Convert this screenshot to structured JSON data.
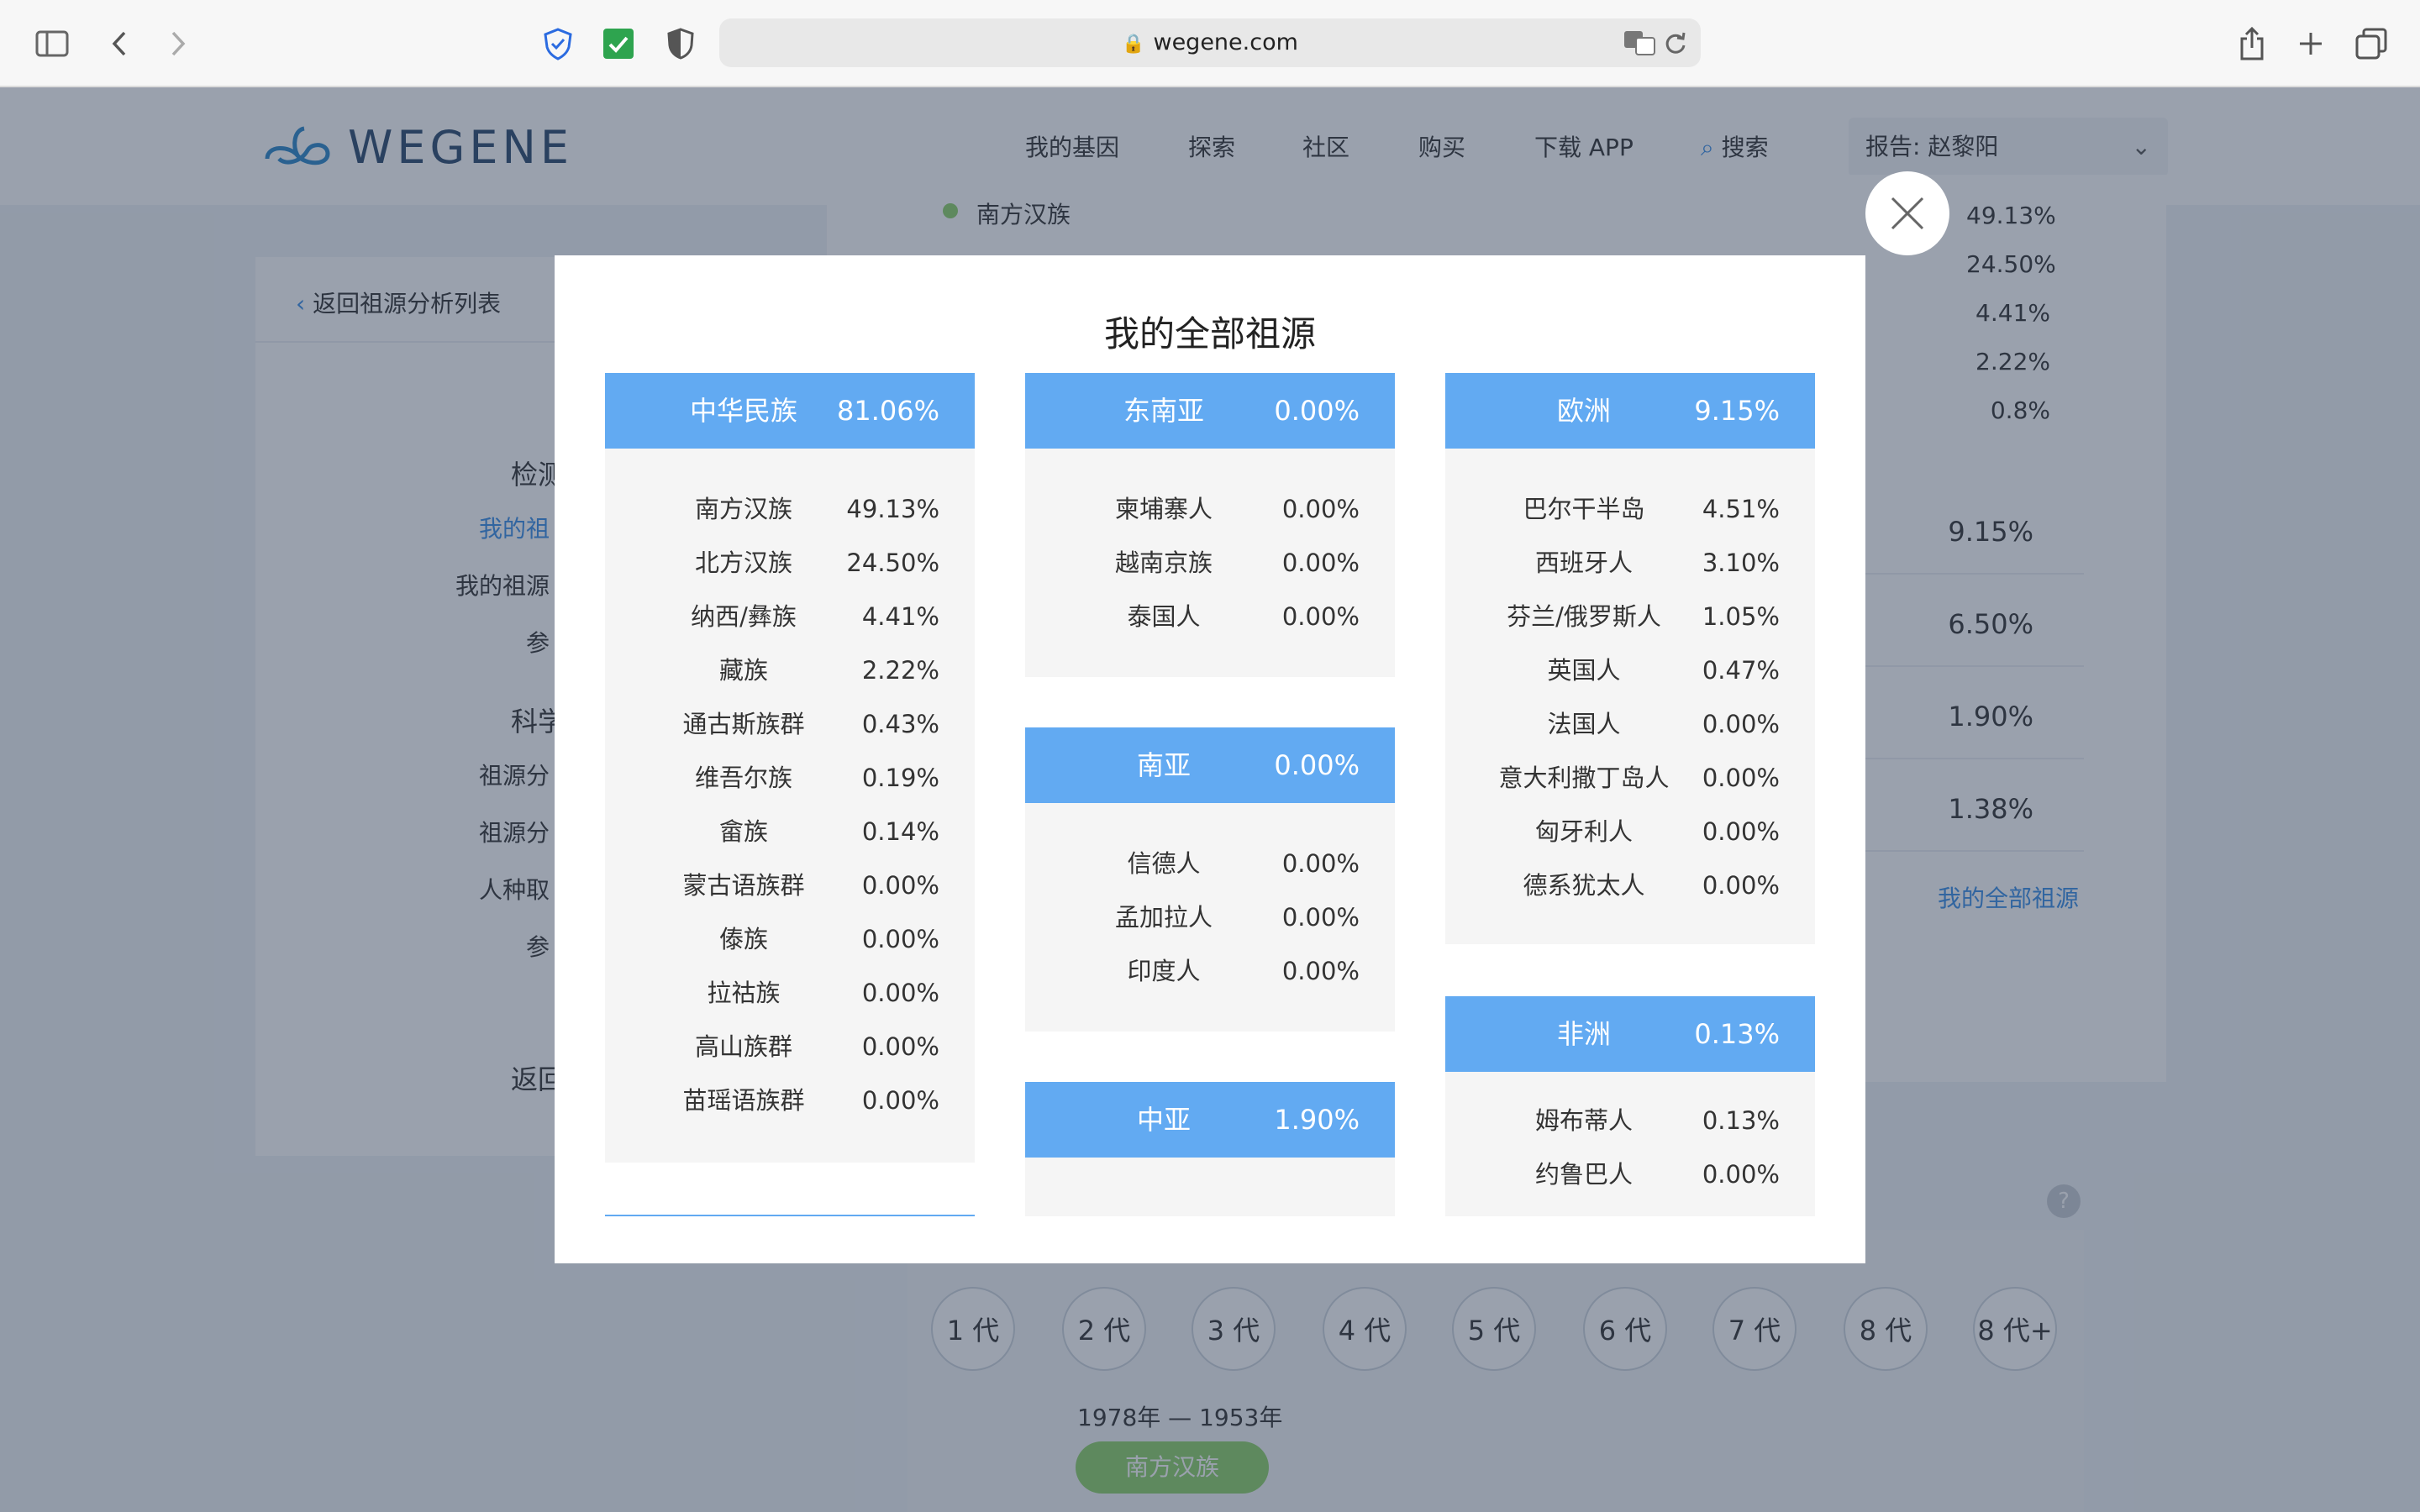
{
  "browser": {
    "url": "wegene.com"
  },
  "site": {
    "logo_text": "WEGENE",
    "nav": [
      "我的基因",
      "探索",
      "社区",
      "购买",
      "下载 APP"
    ],
    "search_label": "搜索",
    "report_label": "报告: 赵黎阳"
  },
  "sidebar": {
    "back_label": "返回祖源分析列表",
    "items": [
      "检测",
      "我的祖",
      "我的祖源",
      "参",
      "科学",
      "祖源分",
      "祖源分",
      "人种取",
      "参",
      "返回"
    ]
  },
  "background": {
    "legend": [
      {
        "name": "南方汉族",
        "pct": "49.13%"
      },
      {
        "name": "",
        "pct": "24.50%"
      },
      {
        "name": "",
        "pct": "4.41%"
      },
      {
        "name": "",
        "pct": "2.22%"
      },
      {
        "name": "",
        "pct": "0.8%"
      }
    ],
    "region_pcts": [
      "9.15%",
      "6.50%",
      "1.90%",
      "1.38%"
    ],
    "all_link": "我的全部祖源",
    "generations": [
      "1 代",
      "2 代",
      "3 代",
      "4 代",
      "5 代",
      "6 代",
      "7 代",
      "8 代",
      "8 代+"
    ],
    "years": "1978年 — 1953年",
    "gen_tag": "南方汉族"
  },
  "modal": {
    "title": "我的全部祖源",
    "columns": [
      [
        {
          "name": "中华民族",
          "pct": "81.06%",
          "rows": [
            [
              "南方汉族",
              "49.13%"
            ],
            [
              "北方汉族",
              "24.50%"
            ],
            [
              "纳西/彝族",
              "4.41%"
            ],
            [
              "藏族",
              "2.22%"
            ],
            [
              "通古斯族群",
              "0.43%"
            ],
            [
              "维吾尔族",
              "0.19%"
            ],
            [
              "畲族",
              "0.14%"
            ],
            [
              "蒙古语族群",
              "0.00%"
            ],
            [
              "傣族",
              "0.00%"
            ],
            [
              "拉祜族",
              "0.00%"
            ],
            [
              "高山族群",
              "0.00%"
            ],
            [
              "苗瑶语族群",
              "0.00%"
            ]
          ]
        }
      ],
      [
        {
          "name": "东南亚",
          "pct": "0.00%",
          "rows": [
            [
              "柬埔寨人",
              "0.00%"
            ],
            [
              "越南京族",
              "0.00%"
            ],
            [
              "泰国人",
              "0.00%"
            ]
          ]
        },
        {
          "name": "南亚",
          "pct": "0.00%",
          "rows": [
            [
              "信德人",
              "0.00%"
            ],
            [
              "孟加拉人",
              "0.00%"
            ],
            [
              "印度人",
              "0.00%"
            ]
          ]
        },
        {
          "name": "中亚",
          "pct": "1.90%",
          "rows": []
        }
      ],
      [
        {
          "name": "欧洲",
          "pct": "9.15%",
          "rows": [
            [
              "巴尔干半岛",
              "4.51%"
            ],
            [
              "西班牙人",
              "3.10%"
            ],
            [
              "芬兰/俄罗斯人",
              "1.05%"
            ],
            [
              "英国人",
              "0.47%"
            ],
            [
              "法国人",
              "0.00%"
            ],
            [
              "意大利撒丁岛人",
              "0.00%"
            ],
            [
              "匈牙利人",
              "0.00%"
            ],
            [
              "德系犹太人",
              "0.00%"
            ]
          ]
        },
        {
          "name": "非洲",
          "pct": "0.13%",
          "rows": [
            [
              "姆布蒂人",
              "0.13%"
            ],
            [
              "约鲁巴人",
              "0.00%"
            ]
          ]
        }
      ]
    ]
  },
  "colors": {
    "card_header": "#62aaf2",
    "link": "#3a8ee6",
    "gen_tag": "#8fd16b"
  }
}
